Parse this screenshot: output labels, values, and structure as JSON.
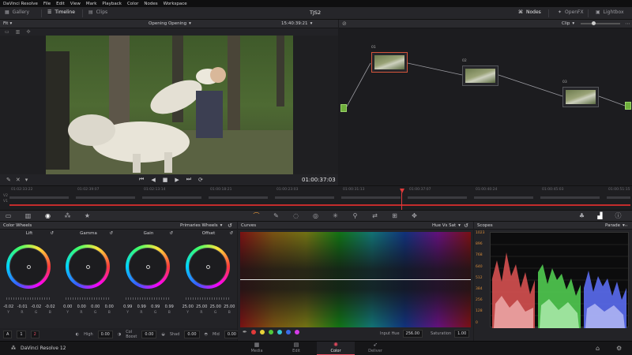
{
  "menubar": {
    "items": [
      "DaVinci Resolve",
      "File",
      "Edit",
      "View",
      "Mark",
      "Playback",
      "Color",
      "Nodes",
      "Workspace"
    ]
  },
  "toolbar": {
    "gallery": "Gallery",
    "timeline": "Timeline",
    "clips": "Clips",
    "title": "TJS2",
    "nodes": "Nodes",
    "openfx": "OpenFX",
    "lightbox": "Lightbox"
  },
  "viewer": {
    "fit": "Fit",
    "clip_name": "Opening Opening",
    "timecode_top": "15:40:39:21",
    "timecode": "01:00:37:03"
  },
  "nodes": {
    "clip_label": "Clip",
    "labels": [
      "01",
      "02",
      "03"
    ]
  },
  "timeline": {
    "track_v": "V2",
    "track_v1": "V1",
    "marks": [
      "01:02:33:22",
      "01:02:39:07",
      "01:02:13:14",
      "01:00:18:21",
      "01:00:23:03",
      "01:00:31:13",
      "01:00:37:07",
      "01:00:40:24",
      "01:00:45:03",
      "01:00:51:15"
    ]
  },
  "color_wheels": {
    "title": "Color Wheels",
    "mode": "Primaries Wheels",
    "wheels": [
      {
        "name": "Lift",
        "vals": [
          "-0.02",
          "-0.01",
          "-0.02",
          "-0.02"
        ]
      },
      {
        "name": "Gamma",
        "vals": [
          "0.00",
          "0.00",
          "0.00",
          "0.00"
        ]
      },
      {
        "name": "Gain",
        "vals": [
          "0.99",
          "0.99",
          "0.99",
          "0.99"
        ]
      },
      {
        "name": "Offset",
        "vals": [
          "25.00",
          "25.00",
          "25.00",
          "25.00"
        ]
      }
    ],
    "keys": [
      "Y",
      "R",
      "G",
      "B"
    ],
    "bottom": {
      "page_a": "A",
      "page_1": "1",
      "page_2": "2",
      "high_label": "High",
      "high_val": "0.00",
      "colboost_label": "Col Boost",
      "colboost_val": "0.00",
      "shad_label": "Shad",
      "shad_val": "0.00",
      "mid_label": "Mid",
      "mid_val": "0.00"
    }
  },
  "curves": {
    "title": "Curves",
    "mode": "Hue Vs Sat",
    "input_hue_label": "Input Hue",
    "input_hue_val": "256.00",
    "saturation_label": "Saturation",
    "saturation_val": "1.00",
    "swatch_colors": [
      "#e23a3a",
      "#e8d23a",
      "#52c93b",
      "#37c9d8",
      "#3b6ce8",
      "#d43be8"
    ]
  },
  "scopes": {
    "title": "Scopes",
    "mode": "Parade",
    "axis": [
      "1023",
      "896",
      "768",
      "640",
      "512",
      "384",
      "256",
      "128",
      "0"
    ]
  },
  "pagebar": {
    "app": "DaVinci Resolve 12",
    "tabs": [
      "Media",
      "Edit",
      "Color",
      "Deliver"
    ],
    "active": "Color"
  }
}
